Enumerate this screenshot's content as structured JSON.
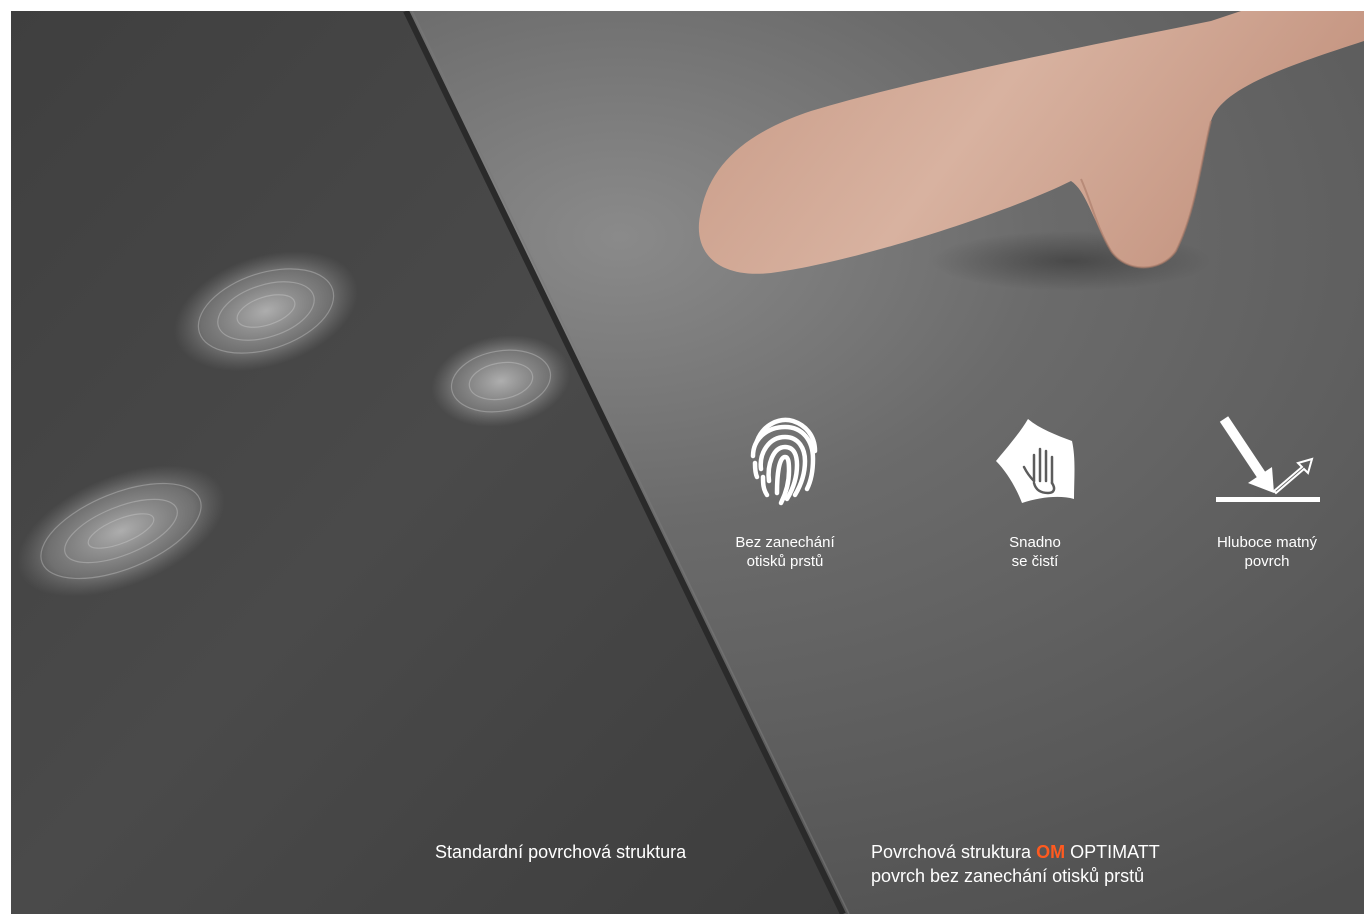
{
  "features": [
    {
      "icon": "fingerprint-icon",
      "line1": "Bez zanechání",
      "line2": "otisků prstů"
    },
    {
      "icon": "cloth-wipe-hand-icon",
      "line1": "Snadno",
      "line2": "se čistí"
    },
    {
      "icon": "light-reflection-icon",
      "line1": "Hluboce matný",
      "line2": "povrch"
    }
  ],
  "captions": {
    "left": "Standardní povrchová struktura",
    "right_prefix": "Povrchová struktura ",
    "right_accent": "OM",
    "right_suffix": " OPTIMATT",
    "right_line2": "povrch bez zanechání otisků prstů"
  },
  "colors": {
    "accent": "#ff5a1f",
    "text": "#ffffff",
    "standard_surface": "#4a4a4a",
    "optimatt_surface": "#5b5b5b"
  }
}
